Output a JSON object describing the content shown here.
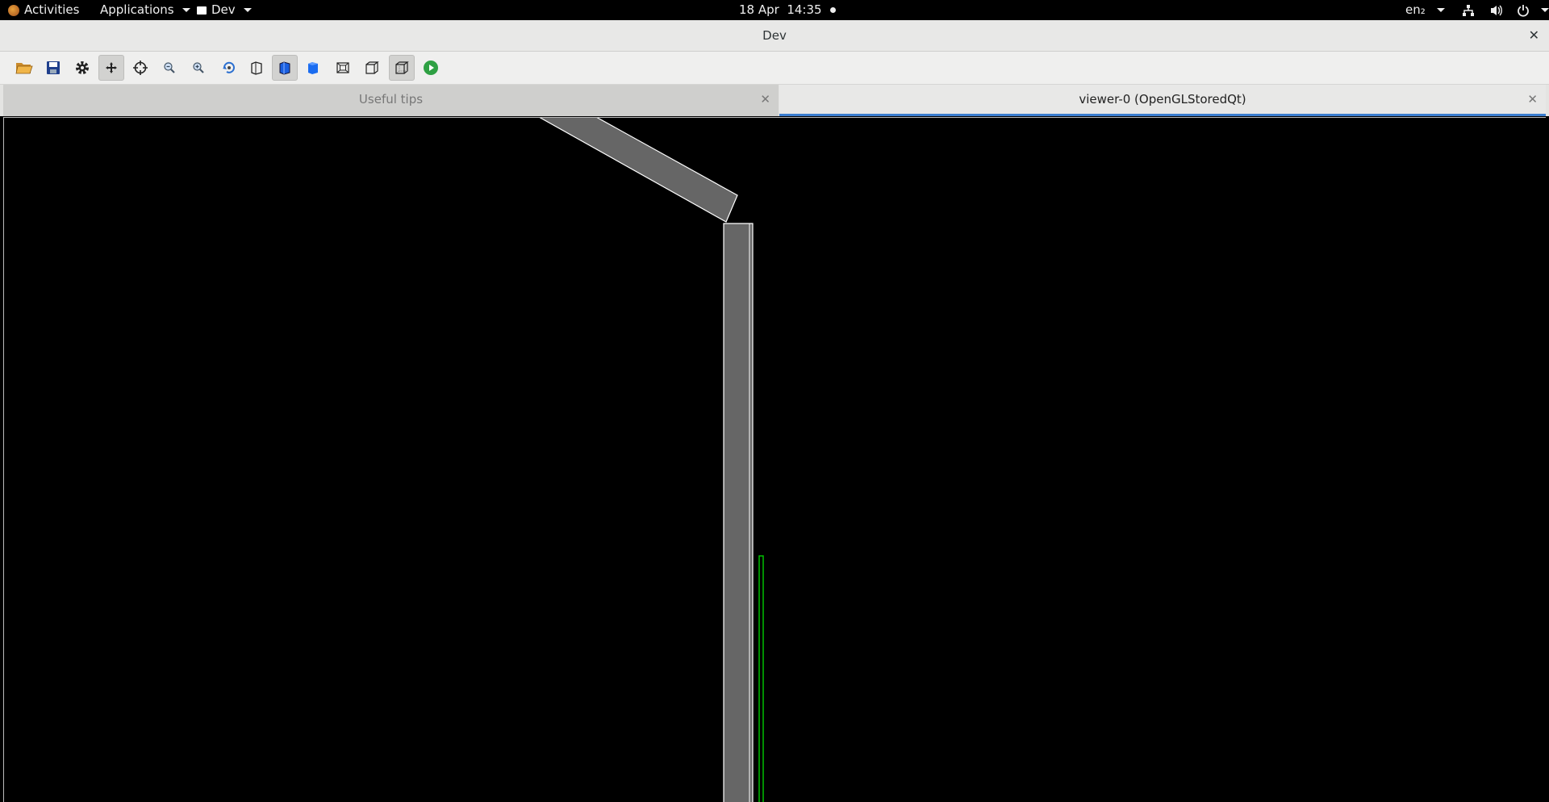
{
  "topbar": {
    "activities": "Activities",
    "applications": "Applications",
    "app_menu": "Dev",
    "clock": "18 Apr  14:35",
    "keyboard": "en₂"
  },
  "window": {
    "title": "Dev",
    "close": "✕"
  },
  "toolbar": {
    "icons": [
      "open-folder-icon",
      "save-icon",
      "settings-gear-icon",
      "move-icon",
      "pick-crosshair-icon",
      "zoom-out-icon",
      "zoom-in-icon",
      "rotate-icon",
      "wireframe-view-icon",
      "solid-view-icon",
      "solid-blue-view-icon",
      "perspective-box-icon",
      "ortho-box-icon",
      "hidden-line-box-icon",
      "run-icon"
    ]
  },
  "tabs": [
    {
      "label": "Useful tips",
      "close": "✕"
    },
    {
      "label": "viewer-0 (OpenGLStoredQt)",
      "close": "✕"
    }
  ],
  "colors": {
    "accent": "#3b7ed1",
    "geometry_fill": "#666666",
    "geometry_edge": "#ffffff",
    "trajectory": "#00cc00"
  }
}
